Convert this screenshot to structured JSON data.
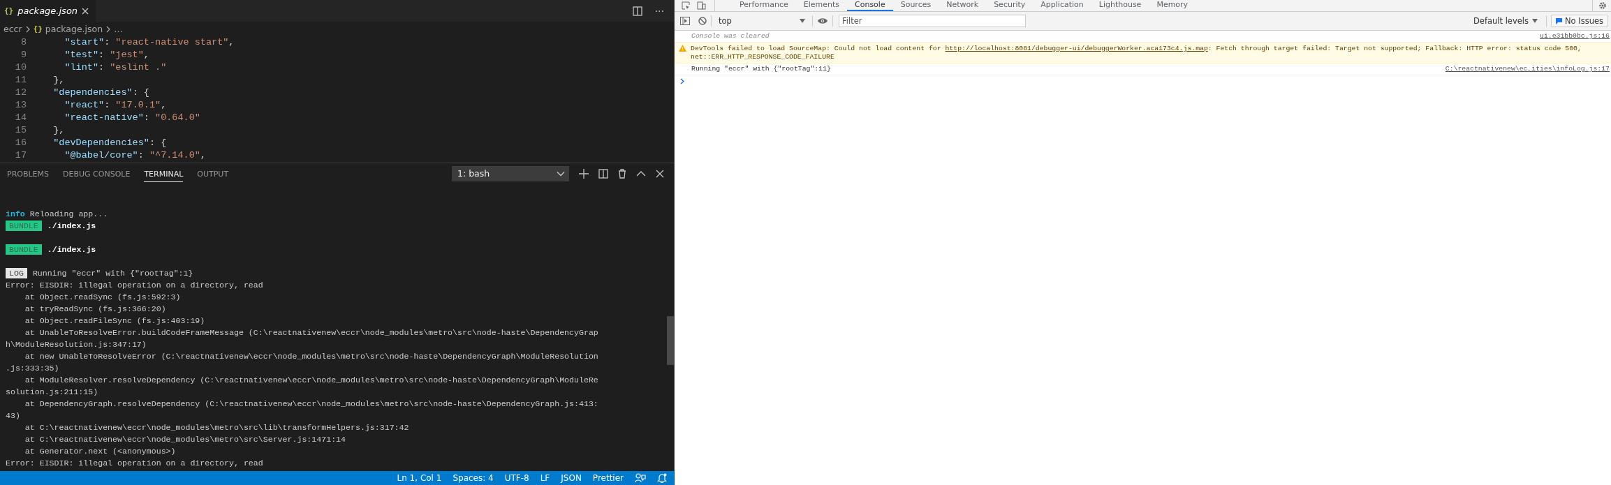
{
  "editor": {
    "tabs": [
      {
        "icon": "{}",
        "label": "package.json",
        "selected": true
      }
    ],
    "more": "···",
    "breadcrumb": [
      {
        "label": "eccr"
      },
      {
        "icon": "{}",
        "label": "package.json"
      },
      {
        "label": "…"
      }
    ],
    "lines": [
      {
        "number": "8",
        "tokens": [
          {
            "kind": "key",
            "text": "    \"start\""
          },
          {
            "kind": "punct",
            "text": ": "
          },
          {
            "kind": "string",
            "text": "\"react-native start\""
          },
          {
            "kind": "punct",
            "text": ","
          }
        ]
      },
      {
        "number": "9",
        "tokens": [
          {
            "kind": "key",
            "text": "    \"test\""
          },
          {
            "kind": "punct",
            "text": ": "
          },
          {
            "kind": "string",
            "text": "\"jest\""
          },
          {
            "kind": "punct",
            "text": ","
          }
        ]
      },
      {
        "number": "10",
        "tokens": [
          {
            "kind": "key",
            "text": "    \"lint\""
          },
          {
            "kind": "punct",
            "text": ": "
          },
          {
            "kind": "string",
            "text": "\"eslint .\""
          }
        ]
      },
      {
        "number": "11",
        "tokens": [
          {
            "kind": "punct",
            "text": "  },"
          }
        ]
      },
      {
        "number": "12",
        "tokens": [
          {
            "kind": "key",
            "text": "  \"dependencies\""
          },
          {
            "kind": "punct",
            "text": ": {"
          }
        ]
      },
      {
        "number": "13",
        "tokens": [
          {
            "kind": "key",
            "text": "    \"react\""
          },
          {
            "kind": "punct",
            "text": ": "
          },
          {
            "kind": "string",
            "text": "\"17.0.1\""
          },
          {
            "kind": "punct",
            "text": ","
          }
        ]
      },
      {
        "number": "14",
        "tokens": [
          {
            "kind": "key",
            "text": "    \"react-native\""
          },
          {
            "kind": "punct",
            "text": ": "
          },
          {
            "kind": "string",
            "text": "\"0.64.0\""
          }
        ]
      },
      {
        "number": "15",
        "tokens": [
          {
            "kind": "punct",
            "text": "  },"
          }
        ]
      },
      {
        "number": "16",
        "tokens": [
          {
            "kind": "key",
            "text": "  \"devDependencies\""
          },
          {
            "kind": "punct",
            "text": ": {"
          }
        ]
      },
      {
        "number": "17",
        "tokens": [
          {
            "kind": "key",
            "text": "    \"@babel/core\""
          },
          {
            "kind": "punct",
            "text": ": "
          },
          {
            "kind": "string",
            "text": "\"^7.14.0\""
          },
          {
            "kind": "punct",
            "text": ","
          }
        ]
      }
    ]
  },
  "panel": {
    "tabs": [
      {
        "label": "PROBLEMS",
        "selected": false
      },
      {
        "label": "DEBUG CONSOLE",
        "selected": false
      },
      {
        "label": "TERMINAL",
        "selected": true
      },
      {
        "label": "OUTPUT",
        "selected": false
      }
    ],
    "terminal_select": "1: bash",
    "terminal": [
      {
        "kind": "info",
        "tag": "info",
        "text": "Reloading app..."
      },
      {
        "kind": "bundle",
        "tag": "BUNDLE",
        "text": "./index.js"
      },
      {
        "kind": "blank"
      },
      {
        "kind": "bundle",
        "tag": "BUNDLE",
        "text": "./index.js"
      },
      {
        "kind": "blank"
      },
      {
        "kind": "log",
        "tag": "LOG",
        "text": "Running \"eccr\" with {\"rootTag\":1}"
      },
      {
        "kind": "plain",
        "text": "Error: EISDIR: illegal operation on a directory, read"
      },
      {
        "kind": "plain",
        "text": "    at Object.readSync (fs.js:592:3)"
      },
      {
        "kind": "plain",
        "text": "    at tryReadSync (fs.js:366:20)"
      },
      {
        "kind": "plain",
        "text": "    at Object.readFileSync (fs.js:403:19)"
      },
      {
        "kind": "plain",
        "text": "    at UnableToResolveError.buildCodeFrameMessage (C:\\reactnativenew\\eccr\\node_modules\\metro\\src\\node-haste\\DependencyGrap"
      },
      {
        "kind": "plain",
        "text": "h\\ModuleResolution.js:347:17)"
      },
      {
        "kind": "plain",
        "text": "    at new UnableToResolveError (C:\\reactnativenew\\eccr\\node_modules\\metro\\src\\node-haste\\DependencyGraph\\ModuleResolution"
      },
      {
        "kind": "plain",
        "text": ".js:333:35)"
      },
      {
        "kind": "plain",
        "text": "    at ModuleResolver.resolveDependency (C:\\reactnativenew\\eccr\\node_modules\\metro\\src\\node-haste\\DependencyGraph\\ModuleRe"
      },
      {
        "kind": "plain",
        "text": "solution.js:211:15)"
      },
      {
        "kind": "plain",
        "text": "    at DependencyGraph.resolveDependency (C:\\reactnativenew\\eccr\\node_modules\\metro\\src\\node-haste\\DependencyGraph.js:413:"
      },
      {
        "kind": "plain",
        "text": "43)"
      },
      {
        "kind": "plain",
        "text": "    at C:\\reactnativenew\\eccr\\node_modules\\metro\\src\\lib\\transformHelpers.js:317:42"
      },
      {
        "kind": "plain",
        "text": "    at C:\\reactnativenew\\eccr\\node_modules\\metro\\src\\Server.js:1471:14"
      },
      {
        "kind": "plain",
        "text": "    at Generator.next (<anonymous>)"
      },
      {
        "kind": "plain",
        "text": "Error: EISDIR: illegal operation on a directory, read"
      }
    ]
  },
  "status_bar": [
    "Ln 1, Col 1",
    "Spaces: 4",
    "UTF-8",
    "LF",
    "JSON",
    "Prettier"
  ],
  "devtools": {
    "tabs": [
      {
        "label": "Performance",
        "selected": false
      },
      {
        "label": "Elements",
        "selected": false
      },
      {
        "label": "Console",
        "selected": true
      },
      {
        "label": "Sources",
        "selected": false
      },
      {
        "label": "Network",
        "selected": false
      },
      {
        "label": "Security",
        "selected": false
      },
      {
        "label": "Application",
        "selected": false
      },
      {
        "label": "Lighthouse",
        "selected": false
      },
      {
        "label": "Memory",
        "selected": false
      }
    ],
    "context": "top",
    "filter": {
      "placeholder": "Filter"
    },
    "levels": "Default levels",
    "issues": "No Issues",
    "messages": [
      {
        "kind": "info",
        "text": "Console was cleared",
        "source": "ui.e31bb0bc.js:16"
      },
      {
        "kind": "warning",
        "text": "DevTools failed to load SourceMap: Could not load content for ",
        "link": "http://localhost:8081/debugger-ui/debuggerWorker.aca173c4.js.map",
        "after": ": Fetch through target failed: Target not supported; Fallback: HTTP error: status code 500, net::ERR_HTTP_RESPONSE_CODE_FAILURE"
      },
      {
        "kind": "log",
        "text": "Running \"eccr\" with {\"rootTag\":11}",
        "source": "C:\\reactnativenew\\ec…ities\\infoLog.js:17"
      }
    ]
  }
}
